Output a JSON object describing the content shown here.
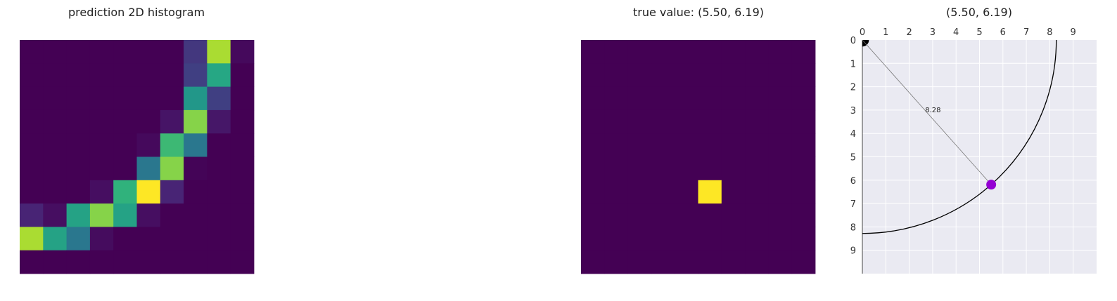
{
  "colors": {
    "viridis_low": "#440154",
    "viridis_high": "#fde725",
    "panel_bg": "#eaeaf2",
    "grid": "#ffffff",
    "point": "#9400d3",
    "line": "#000000"
  },
  "chart_data": [
    {
      "type": "heatmap",
      "title": "prediction 2D histogram",
      "rows": 10,
      "cols": 10,
      "values": [
        [
          0,
          0,
          0,
          0,
          0,
          0,
          0,
          0.18,
          0.88,
          0.03
        ],
        [
          0,
          0,
          0,
          0,
          0,
          0,
          0,
          0.2,
          0.6,
          0
        ],
        [
          0,
          0,
          0,
          0,
          0,
          0,
          0,
          0.53,
          0.2,
          0
        ],
        [
          0,
          0,
          0,
          0,
          0,
          0,
          0.07,
          0.82,
          0.08,
          0
        ],
        [
          0,
          0,
          0,
          0,
          0,
          0.03,
          0.68,
          0.4,
          0,
          0
        ],
        [
          0,
          0,
          0,
          0,
          0,
          0.4,
          0.82,
          0.01,
          0,
          0
        ],
        [
          0,
          0,
          0,
          0.05,
          0.65,
          1.0,
          0.13,
          0,
          0,
          0
        ],
        [
          0.13,
          0.05,
          0.58,
          0.82,
          0.58,
          0.05,
          0,
          0,
          0,
          0
        ],
        [
          0.88,
          0.58,
          0.4,
          0.04,
          0,
          0,
          0,
          0,
          0,
          0
        ],
        [
          0,
          0,
          0,
          0,
          0,
          0,
          0,
          0,
          0,
          0
        ]
      ]
    },
    {
      "type": "heatmap",
      "title": "true value: (5.50, 6.19)",
      "rows": 10,
      "cols": 10,
      "values": [
        [
          0,
          0,
          0,
          0,
          0,
          0,
          0,
          0,
          0,
          0
        ],
        [
          0,
          0,
          0,
          0,
          0,
          0,
          0,
          0,
          0,
          0
        ],
        [
          0,
          0,
          0,
          0,
          0,
          0,
          0,
          0,
          0,
          0
        ],
        [
          0,
          0,
          0,
          0,
          0,
          0,
          0,
          0,
          0,
          0
        ],
        [
          0,
          0,
          0,
          0,
          0,
          0,
          0,
          0,
          0,
          0
        ],
        [
          0,
          0,
          0,
          0,
          0,
          0,
          0,
          0,
          0,
          0
        ],
        [
          0,
          0,
          0,
          0,
          0,
          1,
          0,
          0,
          0,
          0
        ],
        [
          0,
          0,
          0,
          0,
          0,
          0,
          0,
          0,
          0,
          0
        ],
        [
          0,
          0,
          0,
          0,
          0,
          0,
          0,
          0,
          0,
          0
        ],
        [
          0,
          0,
          0,
          0,
          0,
          0,
          0,
          0,
          0,
          0
        ]
      ]
    },
    {
      "type": "scatter",
      "title": "(5.50, 6.19)",
      "xlim": [
        0,
        10
      ],
      "ylim": [
        0,
        10
      ],
      "y_inverted": true,
      "x_ticks": [
        "0",
        "1",
        "2",
        "3",
        "4",
        "5",
        "6",
        "7",
        "8",
        "9"
      ],
      "y_ticks": [
        "0",
        "1",
        "2",
        "3",
        "4",
        "5",
        "6",
        "7",
        "8",
        "9"
      ],
      "x_axis_position": "top",
      "grid": true,
      "point": {
        "x": 5.5,
        "y": 6.19
      },
      "arc_radius": 8.28,
      "distance_label": "8.28",
      "origin_wedge_radius": 0.28
    }
  ]
}
